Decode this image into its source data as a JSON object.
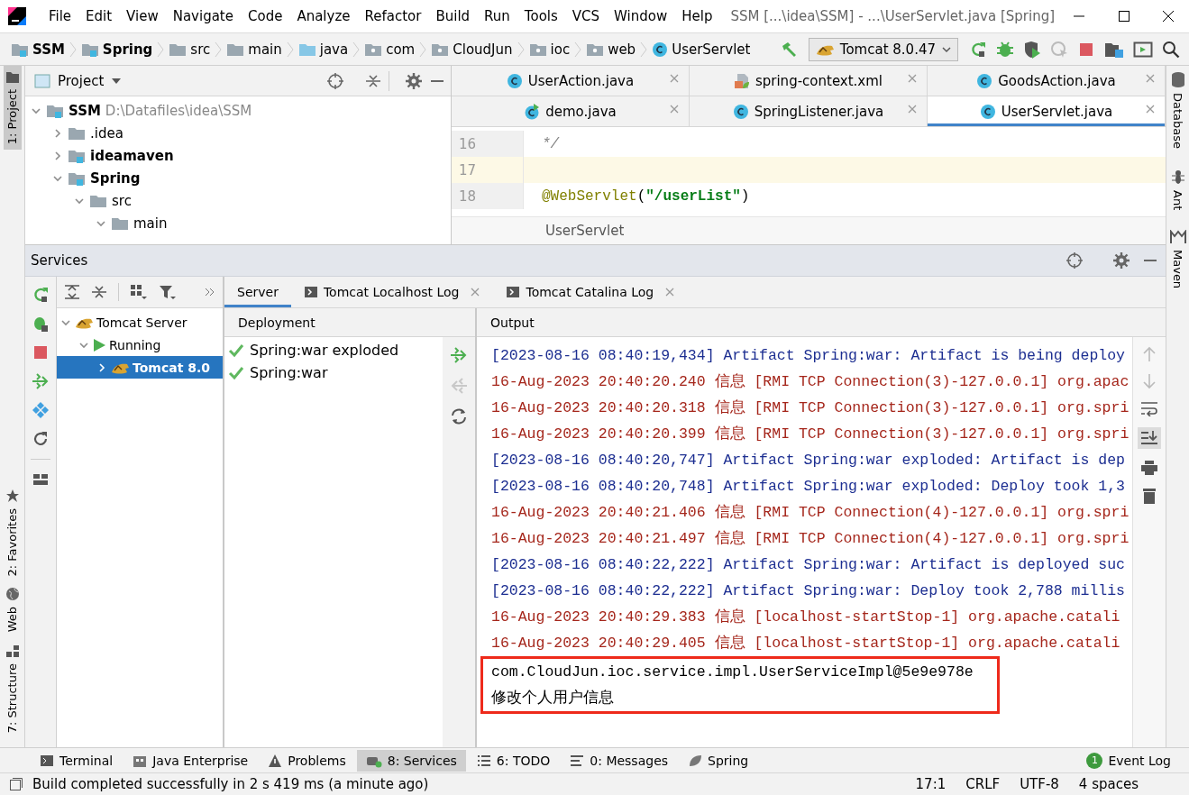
{
  "window": {
    "title": "SSM [...\\idea\\SSM] - ...\\UserServlet.java [Spring]"
  },
  "menu": [
    "File",
    "Edit",
    "View",
    "Navigate",
    "Code",
    "Analyze",
    "Refactor",
    "Build",
    "Run",
    "Tools",
    "VCS",
    "Window",
    "Help"
  ],
  "breadcrumbs": [
    {
      "label": "SSM",
      "kind": "module"
    },
    {
      "label": "Spring",
      "kind": "module"
    },
    {
      "label": "src",
      "kind": "folder"
    },
    {
      "label": "main",
      "kind": "folder"
    },
    {
      "label": "java",
      "kind": "source"
    },
    {
      "label": "com",
      "kind": "package"
    },
    {
      "label": "CloudJun",
      "kind": "package"
    },
    {
      "label": "ioc",
      "kind": "package"
    },
    {
      "label": "web",
      "kind": "package"
    },
    {
      "label": "UserServlet",
      "kind": "class"
    }
  ],
  "run_config": "Tomcat 8.0.47",
  "left_stripe": {
    "top": [
      {
        "label": "1: Project",
        "selected": true
      }
    ],
    "bottom": [
      {
        "label": "2: Favorites",
        "selected": false
      },
      {
        "label": "Web",
        "selected": false
      },
      {
        "label": "7: Structure",
        "selected": false
      }
    ]
  },
  "right_stripe": [
    "Database",
    "Ant",
    "Maven"
  ],
  "project": {
    "title": "Project",
    "tree": [
      {
        "label": "SSM",
        "path": "D:\\Datafiles\\idea\\SSM",
        "kind": "module",
        "expanded": true,
        "children": [
          {
            "label": ".idea",
            "kind": "folder",
            "expanded": false
          },
          {
            "label": "ideamaven",
            "kind": "module",
            "expanded": false
          },
          {
            "label": "Spring",
            "kind": "module",
            "expanded": true,
            "children": [
              {
                "label": "src",
                "kind": "folder",
                "expanded": true,
                "children": [
                  {
                    "label": "main",
                    "kind": "folder",
                    "expanded": true
                  }
                ]
              }
            ]
          }
        ]
      }
    ]
  },
  "editor": {
    "tab_rows": [
      [
        {
          "label": "UserAction.java",
          "kind": "class",
          "selected": false
        },
        {
          "label": "spring-context.xml",
          "kind": "xml",
          "selected": false
        },
        {
          "label": "GoodsAction.java",
          "kind": "class",
          "selected": false
        }
      ],
      [
        {
          "label": "demo.java",
          "kind": "runnable",
          "selected": false
        },
        {
          "label": "SpringListener.java",
          "kind": "class",
          "selected": false
        },
        {
          "label": "UserServlet.java",
          "kind": "class",
          "selected": true
        }
      ]
    ],
    "lines": [
      {
        "number": "16",
        "current": false,
        "tokens": [
          {
            "text": "*/",
            "kind": "comment"
          }
        ]
      },
      {
        "number": "17",
        "current": true
      },
      {
        "number": "18",
        "current": false,
        "tokens": [
          {
            "text": "@WebServlet",
            "kind": "annotation"
          },
          {
            "text": "(",
            "kind": "plain"
          },
          {
            "text": "\"/userList\"",
            "kind": "string"
          },
          {
            "text": ")",
            "kind": "plain"
          }
        ]
      }
    ],
    "breadcrumb": "UserServlet"
  },
  "services": {
    "title": "Services",
    "tree": [
      {
        "label": "Tomcat Server",
        "kind": "server",
        "expanded": true,
        "selected": false,
        "children": [
          {
            "label": "Running",
            "kind": "running",
            "expanded": true,
            "selected": false,
            "children": [
              {
                "label": "Tomcat 8.0",
                "kind": "instance",
                "expanded": false,
                "selected": true
              }
            ]
          }
        ]
      }
    ],
    "tabs": [
      {
        "label": "Server",
        "closable": false,
        "selected": true
      },
      {
        "label": "Tomcat Localhost Log",
        "closable": true,
        "selected": false
      },
      {
        "label": "Tomcat Catalina Log",
        "closable": true,
        "selected": false
      }
    ],
    "deployment": {
      "title": "Deployment",
      "artifacts": [
        "Spring:war exploded",
        "Spring:war"
      ]
    },
    "output": {
      "title": "Output",
      "lines": [
        {
          "kind": "artifact",
          "text": "[2023-08-16 08:40:19,434] Artifact Spring:war: Artifact is being deploy"
        },
        {
          "kind": "log",
          "text": "16-Aug-2023 20:40:20.240 信息 [RMI TCP Connection(3)-127.0.0.1] org.apac"
        },
        {
          "kind": "log",
          "text": "16-Aug-2023 20:40:20.318 信息 [RMI TCP Connection(3)-127.0.0.1] org.spri"
        },
        {
          "kind": "log",
          "text": "16-Aug-2023 20:40:20.399 信息 [RMI TCP Connection(3)-127.0.0.1] org.spri"
        },
        {
          "kind": "artifact",
          "text": "[2023-08-16 08:40:20,747] Artifact Spring:war exploded: Artifact is dep"
        },
        {
          "kind": "artifact",
          "text": "[2023-08-16 08:40:20,748] Artifact Spring:war exploded: Deploy took 1,3"
        },
        {
          "kind": "log",
          "text": "16-Aug-2023 20:40:21.406 信息 [RMI TCP Connection(4)-127.0.0.1] org.spri"
        },
        {
          "kind": "log",
          "text": "16-Aug-2023 20:40:21.497 信息 [RMI TCP Connection(4)-127.0.0.1] org.spri"
        },
        {
          "kind": "artifact",
          "text": "[2023-08-16 08:40:22,222] Artifact Spring:war: Artifact is deployed suc"
        },
        {
          "kind": "artifact",
          "text": "[2023-08-16 08:40:22,222] Artifact Spring:war: Deploy took 2,788 millis"
        },
        {
          "kind": "log",
          "text": "16-Aug-2023 20:40:29.383 信息 [localhost-startStop-1] org.apache.catali"
        },
        {
          "kind": "log",
          "text": "16-Aug-2023 20:40:29.405 信息 [localhost-startStop-1] org.apache.catali"
        }
      ],
      "highlighted_lines": [
        "com.CloudJun.ioc.service.impl.UserServiceImpl@5e9e978e",
        "修改个人用户信息"
      ]
    }
  },
  "tool_windows": [
    {
      "label": "Terminal",
      "kind": "terminal",
      "selected": false
    },
    {
      "label": "Java Enterprise",
      "kind": "enterprise",
      "selected": false
    },
    {
      "label": "Problems",
      "kind": "problems",
      "selected": false
    },
    {
      "label": "8: Services",
      "kind": "services",
      "selected": true
    },
    {
      "label": "6: TODO",
      "kind": "todo",
      "selected": false
    },
    {
      "label": "0: Messages",
      "kind": "messages",
      "selected": false
    },
    {
      "label": "Spring",
      "kind": "spring",
      "selected": false
    }
  ],
  "event_log": {
    "label": "Event Log",
    "count": "1"
  },
  "status_bar": {
    "message": "Build completed successfully in 2 s 419 ms (a minute ago)",
    "position": "17:1",
    "line_separator": "CRLF",
    "encoding": "UTF-8",
    "indent": "4 spaces"
  }
}
